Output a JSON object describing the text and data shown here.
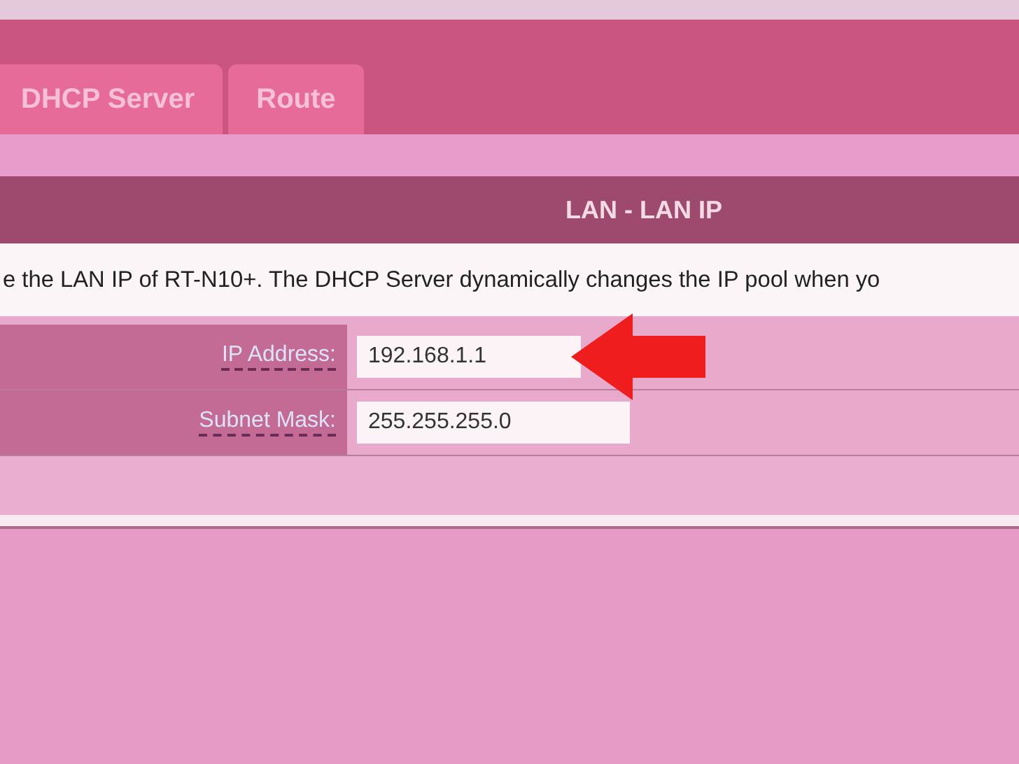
{
  "tabs": [
    {
      "label": "DHCP Server"
    },
    {
      "label": "Route"
    }
  ],
  "section": {
    "title": "LAN - LAN IP",
    "description": "e the LAN IP of RT-N10+. The DHCP Server dynamically changes the IP pool when yo"
  },
  "fields": [
    {
      "label": "IP Address:",
      "value": "192.168.1.1"
    },
    {
      "label": "Subnet Mask:",
      "value": "255.255.255.0"
    }
  ]
}
